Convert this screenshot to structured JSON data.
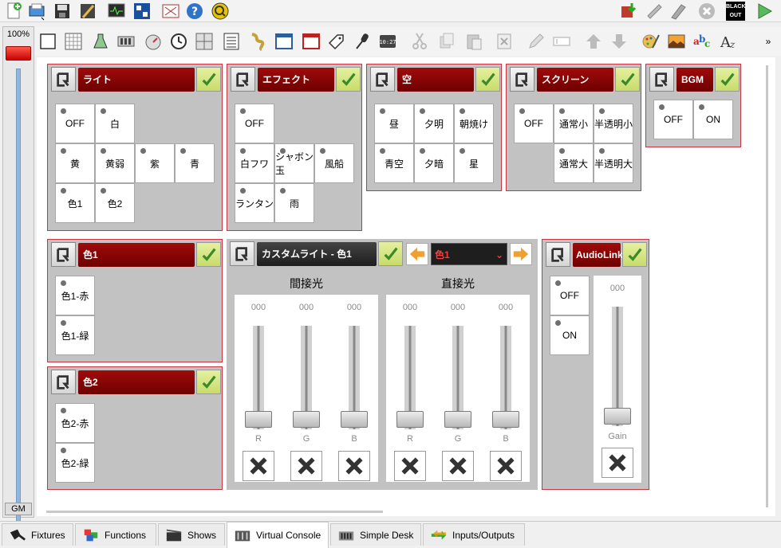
{
  "grand_master": {
    "percent": "100%",
    "label": "GM"
  },
  "tabs": [
    {
      "label": "Fixtures"
    },
    {
      "label": "Functions"
    },
    {
      "label": "Shows"
    },
    {
      "label": "Virtual Console"
    },
    {
      "label": "Simple Desk"
    },
    {
      "label": "Inputs/Outputs"
    }
  ],
  "top_toolbar": {
    "blackout_label": "BLACK OUT"
  },
  "frames": {
    "light": {
      "title": "ライト",
      "buttons": [
        "OFF",
        "白",
        "黄",
        "黄弱",
        "紫",
        "青",
        "色1",
        "色2"
      ]
    },
    "effect": {
      "title": "エフェクト",
      "buttons": [
        "OFF",
        "白フワ",
        "シャボン玉",
        "風船",
        "ランタン",
        "雨"
      ]
    },
    "sky": {
      "title": "空",
      "buttons": [
        "昼",
        "夕明",
        "朝焼け",
        "青空",
        "夕暗",
        "星"
      ]
    },
    "screen": {
      "title": "スクリーン",
      "buttons": [
        "OFF",
        "通常小",
        "半透明小",
        "通常大",
        "半透明大"
      ]
    },
    "bgm": {
      "title": "BGM",
      "buttons": [
        "OFF",
        "ON"
      ]
    },
    "color1": {
      "title": "色1",
      "buttons": [
        "色1-赤",
        "色1-緑"
      ]
    },
    "color2": {
      "title": "色2",
      "buttons": [
        "色2-赤",
        "色2-緑"
      ]
    },
    "custom": {
      "title": "カスタムライト - 色1",
      "select_value": "色1",
      "left_label": "間接光",
      "right_label": "直接光",
      "sliders": [
        {
          "value": "000",
          "label": "R"
        },
        {
          "value": "000",
          "label": "G"
        },
        {
          "value": "000",
          "label": "B"
        },
        {
          "value": "000",
          "label": "R"
        },
        {
          "value": "000",
          "label": "G"
        },
        {
          "value": "000",
          "label": "B"
        }
      ]
    },
    "audio": {
      "title": "AudioLink",
      "buttons": [
        "OFF",
        "ON"
      ],
      "slider": {
        "value": "000",
        "label": "Gain"
      }
    }
  }
}
